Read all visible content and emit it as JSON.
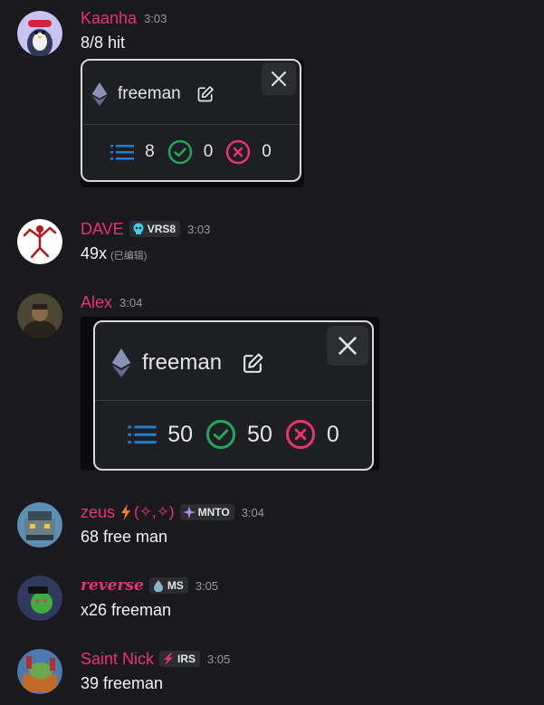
{
  "messages": [
    {
      "username": "Kaanha",
      "time": "3:03",
      "text": "8/8 hit",
      "embed": {
        "title": "freeman",
        "total": "8",
        "success": "0",
        "failed": "0"
      }
    },
    {
      "username": "DAVE",
      "badge": "VRS8",
      "time": "3:03",
      "text": "49x",
      "edited": "(已编辑)"
    },
    {
      "username": "Alex",
      "time": "3:04",
      "embed": {
        "title": "freeman",
        "total": "50",
        "success": "50",
        "failed": "0"
      }
    },
    {
      "username": "zeus",
      "extra": "(✧,✧)",
      "badge": "MNTO",
      "time": "3:04",
      "text": "68 free man"
    },
    {
      "username": "reverse",
      "badge": "MS",
      "time": "3:05",
      "text": "x26 freeman"
    },
    {
      "username": "Saint Nick",
      "badge": "IRS",
      "time": "3:05",
      "text": "39 freeman"
    }
  ],
  "colors": {
    "username": "#e8336d",
    "background": "#1a1a1e",
    "success": "#23a55a",
    "failed": "#e8336d",
    "list": "#1e7fd8"
  },
  "icons": [
    "ethereum-icon",
    "edit-icon",
    "list-icon",
    "check-circle-icon",
    "x-circle-icon",
    "close-icon",
    "skull-icon",
    "sparkle-icon",
    "drop-icon",
    "bolt-icon"
  ]
}
